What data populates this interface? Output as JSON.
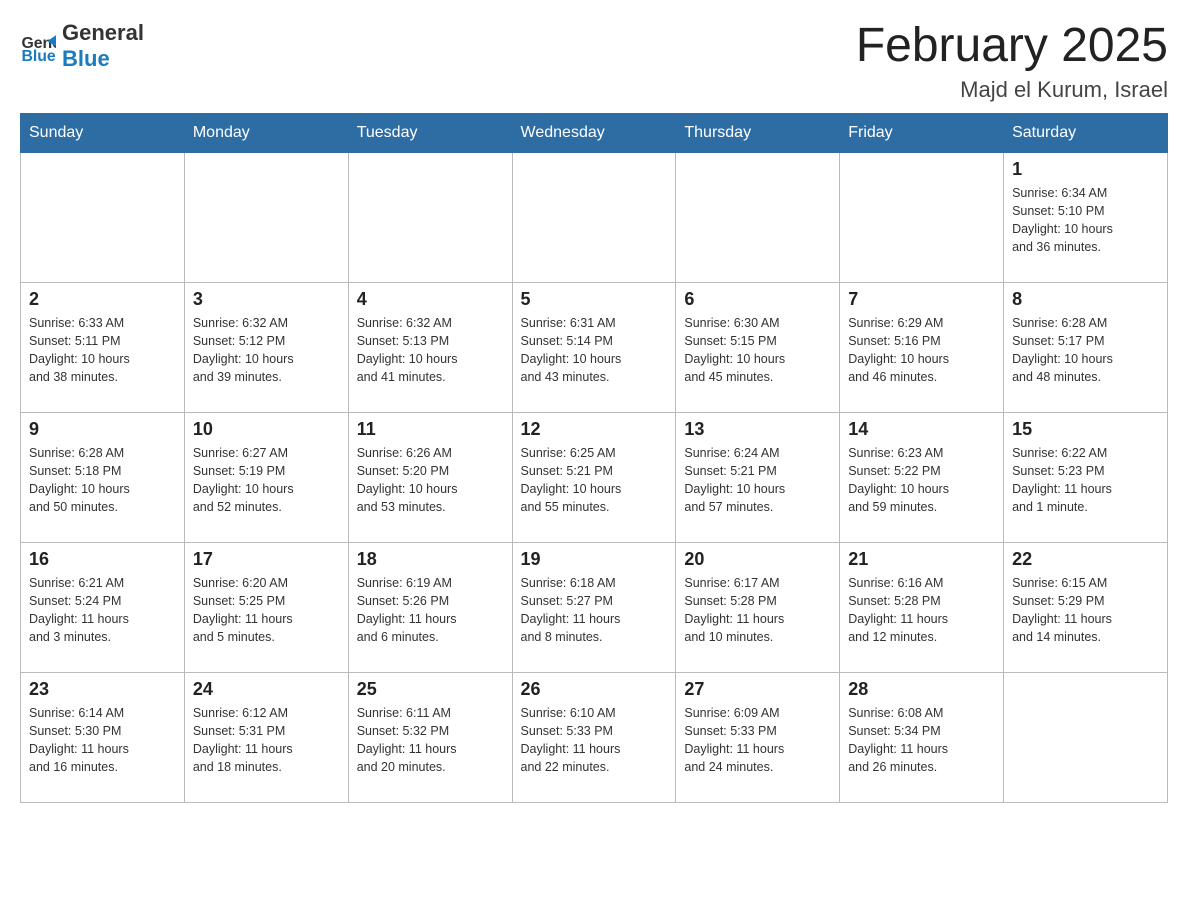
{
  "header": {
    "logo_general": "General",
    "logo_blue": "Blue",
    "title": "February 2025",
    "subtitle": "Majd el Kurum, Israel"
  },
  "weekdays": [
    "Sunday",
    "Monday",
    "Tuesday",
    "Wednesday",
    "Thursday",
    "Friday",
    "Saturday"
  ],
  "weeks": [
    [
      {
        "day": "",
        "info": ""
      },
      {
        "day": "",
        "info": ""
      },
      {
        "day": "",
        "info": ""
      },
      {
        "day": "",
        "info": ""
      },
      {
        "day": "",
        "info": ""
      },
      {
        "day": "",
        "info": ""
      },
      {
        "day": "1",
        "info": "Sunrise: 6:34 AM\nSunset: 5:10 PM\nDaylight: 10 hours\nand 36 minutes."
      }
    ],
    [
      {
        "day": "2",
        "info": "Sunrise: 6:33 AM\nSunset: 5:11 PM\nDaylight: 10 hours\nand 38 minutes."
      },
      {
        "day": "3",
        "info": "Sunrise: 6:32 AM\nSunset: 5:12 PM\nDaylight: 10 hours\nand 39 minutes."
      },
      {
        "day": "4",
        "info": "Sunrise: 6:32 AM\nSunset: 5:13 PM\nDaylight: 10 hours\nand 41 minutes."
      },
      {
        "day": "5",
        "info": "Sunrise: 6:31 AM\nSunset: 5:14 PM\nDaylight: 10 hours\nand 43 minutes."
      },
      {
        "day": "6",
        "info": "Sunrise: 6:30 AM\nSunset: 5:15 PM\nDaylight: 10 hours\nand 45 minutes."
      },
      {
        "day": "7",
        "info": "Sunrise: 6:29 AM\nSunset: 5:16 PM\nDaylight: 10 hours\nand 46 minutes."
      },
      {
        "day": "8",
        "info": "Sunrise: 6:28 AM\nSunset: 5:17 PM\nDaylight: 10 hours\nand 48 minutes."
      }
    ],
    [
      {
        "day": "9",
        "info": "Sunrise: 6:28 AM\nSunset: 5:18 PM\nDaylight: 10 hours\nand 50 minutes."
      },
      {
        "day": "10",
        "info": "Sunrise: 6:27 AM\nSunset: 5:19 PM\nDaylight: 10 hours\nand 52 minutes."
      },
      {
        "day": "11",
        "info": "Sunrise: 6:26 AM\nSunset: 5:20 PM\nDaylight: 10 hours\nand 53 minutes."
      },
      {
        "day": "12",
        "info": "Sunrise: 6:25 AM\nSunset: 5:21 PM\nDaylight: 10 hours\nand 55 minutes."
      },
      {
        "day": "13",
        "info": "Sunrise: 6:24 AM\nSunset: 5:21 PM\nDaylight: 10 hours\nand 57 minutes."
      },
      {
        "day": "14",
        "info": "Sunrise: 6:23 AM\nSunset: 5:22 PM\nDaylight: 10 hours\nand 59 minutes."
      },
      {
        "day": "15",
        "info": "Sunrise: 6:22 AM\nSunset: 5:23 PM\nDaylight: 11 hours\nand 1 minute."
      }
    ],
    [
      {
        "day": "16",
        "info": "Sunrise: 6:21 AM\nSunset: 5:24 PM\nDaylight: 11 hours\nand 3 minutes."
      },
      {
        "day": "17",
        "info": "Sunrise: 6:20 AM\nSunset: 5:25 PM\nDaylight: 11 hours\nand 5 minutes."
      },
      {
        "day": "18",
        "info": "Sunrise: 6:19 AM\nSunset: 5:26 PM\nDaylight: 11 hours\nand 6 minutes."
      },
      {
        "day": "19",
        "info": "Sunrise: 6:18 AM\nSunset: 5:27 PM\nDaylight: 11 hours\nand 8 minutes."
      },
      {
        "day": "20",
        "info": "Sunrise: 6:17 AM\nSunset: 5:28 PM\nDaylight: 11 hours\nand 10 minutes."
      },
      {
        "day": "21",
        "info": "Sunrise: 6:16 AM\nSunset: 5:28 PM\nDaylight: 11 hours\nand 12 minutes."
      },
      {
        "day": "22",
        "info": "Sunrise: 6:15 AM\nSunset: 5:29 PM\nDaylight: 11 hours\nand 14 minutes."
      }
    ],
    [
      {
        "day": "23",
        "info": "Sunrise: 6:14 AM\nSunset: 5:30 PM\nDaylight: 11 hours\nand 16 minutes."
      },
      {
        "day": "24",
        "info": "Sunrise: 6:12 AM\nSunset: 5:31 PM\nDaylight: 11 hours\nand 18 minutes."
      },
      {
        "day": "25",
        "info": "Sunrise: 6:11 AM\nSunset: 5:32 PM\nDaylight: 11 hours\nand 20 minutes."
      },
      {
        "day": "26",
        "info": "Sunrise: 6:10 AM\nSunset: 5:33 PM\nDaylight: 11 hours\nand 22 minutes."
      },
      {
        "day": "27",
        "info": "Sunrise: 6:09 AM\nSunset: 5:33 PM\nDaylight: 11 hours\nand 24 minutes."
      },
      {
        "day": "28",
        "info": "Sunrise: 6:08 AM\nSunset: 5:34 PM\nDaylight: 11 hours\nand 26 minutes."
      },
      {
        "day": "",
        "info": ""
      }
    ]
  ]
}
